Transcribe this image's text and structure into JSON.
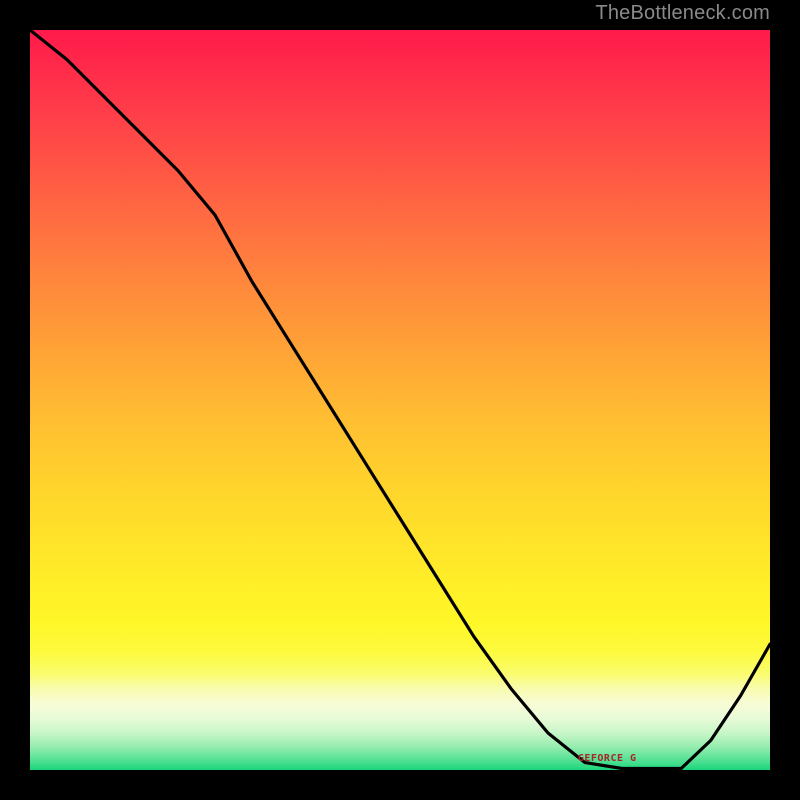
{
  "attribution": "TheBottleneck.com",
  "chart_data": {
    "type": "line",
    "title": "",
    "xlabel": "",
    "ylabel": "",
    "xlim": [
      0,
      100
    ],
    "ylim": [
      0,
      100
    ],
    "series": [
      {
        "name": "curve",
        "x": [
          0,
          5,
          10,
          15,
          20,
          25,
          30,
          35,
          40,
          45,
          50,
          55,
          60,
          65,
          70,
          75,
          80,
          85,
          88,
          92,
          96,
          100
        ],
        "values": [
          100,
          96,
          91,
          86,
          81,
          75,
          66,
          58,
          50,
          42,
          34,
          26,
          18,
          11,
          5,
          1,
          0.2,
          0.2,
          0.2,
          4,
          10,
          17
        ]
      }
    ],
    "plateau_label": "GEFORCE G",
    "plateau_label_x_pct": 78,
    "gradient_stops": [
      {
        "pct": 0,
        "color": "#ff1a4b"
      },
      {
        "pct": 50,
        "color": "#ffc22f"
      },
      {
        "pct": 80,
        "color": "#fff728"
      },
      {
        "pct": 100,
        "color": "#18d67a"
      }
    ]
  }
}
